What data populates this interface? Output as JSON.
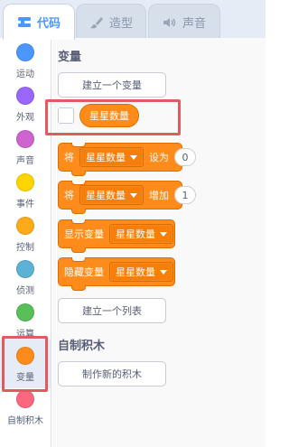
{
  "tabs": {
    "code": {
      "label": "代码",
      "icon": "code-icon"
    },
    "costume": {
      "label": "造型",
      "icon": "brush-icon"
    },
    "sound": {
      "label": "声音",
      "icon": "speaker-icon"
    }
  },
  "categories": [
    {
      "label": "运动",
      "color": "#4c97ff"
    },
    {
      "label": "外观",
      "color": "#9966ff"
    },
    {
      "label": "声音",
      "color": "#cf63cf"
    },
    {
      "label": "事件",
      "color": "#ffd500"
    },
    {
      "label": "控制",
      "color": "#ffab19"
    },
    {
      "label": "侦测",
      "color": "#5cb1d6"
    },
    {
      "label": "运算",
      "color": "#59c059"
    },
    {
      "label": "变量",
      "color": "#ff8c1a"
    },
    {
      "label": "自制积木",
      "color": "#ff6680"
    }
  ],
  "palette": {
    "variables_title": "变量",
    "make_variable": "建立一个变量",
    "variable_name": "星星数量",
    "set_block": {
      "keyword": "将",
      "variable": "星星数量",
      "action": "设为",
      "value": "0"
    },
    "change_block": {
      "keyword": "将",
      "variable": "星星数量",
      "action": "增加",
      "value": "1"
    },
    "show_block": {
      "keyword": "显示变量",
      "variable": "星星数量"
    },
    "hide_block": {
      "keyword": "隐藏变量",
      "variable": "星星数量"
    },
    "make_list": "建立一个列表",
    "my_blocks_title": "自制积木",
    "make_block": "制作新的积木"
  },
  "colors": {
    "accent": "#4c97ff",
    "variables": "#ff8c1a",
    "highlight": "#e05a60"
  }
}
